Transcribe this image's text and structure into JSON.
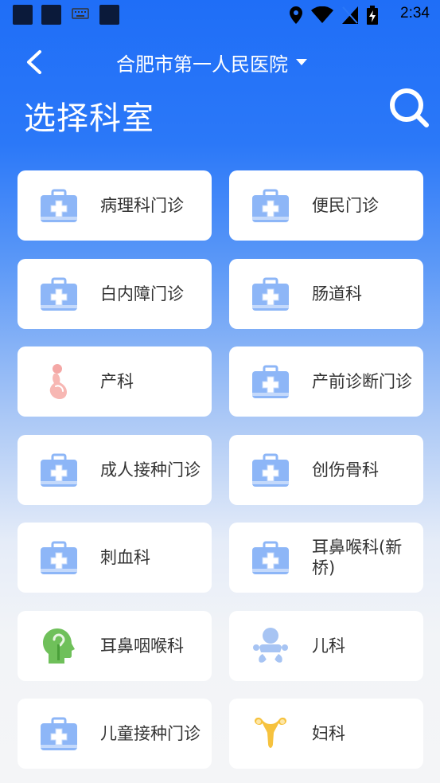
{
  "status_bar": {
    "time": "2:34"
  },
  "header": {
    "back_label": "",
    "hospital_name": "合肥市第一人民医院",
    "title": "选择科室"
  },
  "departments": [
    {
      "label": "病理科门诊",
      "icon": "medical-kit-icon"
    },
    {
      "label": "便民门诊",
      "icon": "medical-kit-icon"
    },
    {
      "label": "白内障门诊",
      "icon": "medical-kit-icon"
    },
    {
      "label": "肠道科",
      "icon": "medical-kit-icon"
    },
    {
      "label": "产科",
      "icon": "pregnant-woman-icon"
    },
    {
      "label": "产前诊断门诊",
      "icon": "medical-kit-icon"
    },
    {
      "label": "成人接种门诊",
      "icon": "medical-kit-icon"
    },
    {
      "label": "创伤骨科",
      "icon": "medical-kit-icon"
    },
    {
      "label": "刺血科",
      "icon": "medical-kit-icon"
    },
    {
      "label": "耳鼻喉科(新桥)",
      "icon": "medical-kit-icon"
    },
    {
      "label": "耳鼻咽喉科",
      "icon": "head-ear-icon"
    },
    {
      "label": "儿科",
      "icon": "baby-icon"
    },
    {
      "label": "儿童接种门诊",
      "icon": "medical-kit-icon"
    },
    {
      "label": "妇科",
      "icon": "uterus-icon"
    }
  ],
  "colors": {
    "primary": "#1f6ef7",
    "kit_blue": "#8db6f7",
    "card_bg": "#ffffff",
    "text": "#333333"
  }
}
